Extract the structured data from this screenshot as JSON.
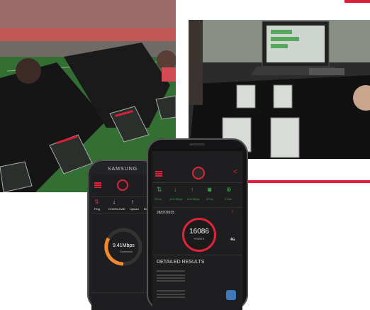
{
  "samsung_phone": {
    "brand": "SAMSUNG",
    "tabs": [
      "Ping",
      "DOWNLOAD",
      "Upload",
      "Browse"
    ],
    "speed": "9.41Mbps",
    "speed_caption": "Download"
  },
  "iphone": {
    "stats": [
      "25ms",
      "31.2 Mbps",
      "10.8 Mbps",
      "87ms",
      "0.04s"
    ],
    "date": "28/07/2015",
    "score": "16086",
    "score_unit": "POINTS",
    "network": "4G",
    "section_title": "DETAILED RESULTS",
    "colors": {
      "accent": "#e0233a",
      "good": "#39a84a",
      "bg": "#1e1e20"
    }
  }
}
